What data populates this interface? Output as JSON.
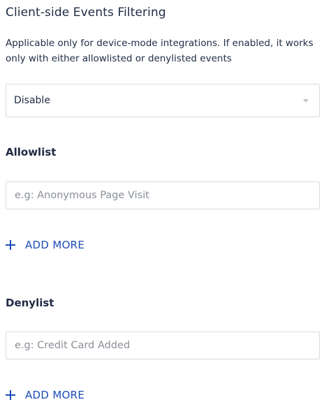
{
  "section": {
    "title": "Client-side Events Filtering",
    "description": "Applicable only for device-mode integrations. If enabled, it works only with either allowlisted or denylisted events"
  },
  "filter_select": {
    "selected": "Disable"
  },
  "allowlist": {
    "label": "Allowlist",
    "placeholder": "e.g: Anonymous Page Visit",
    "value": "",
    "add_more_label": "ADD MORE"
  },
  "denylist": {
    "label": "Denylist",
    "placeholder": "e.g: Credit Card Added",
    "value": "",
    "add_more_label": "ADD MORE"
  },
  "colors": {
    "text": "#1f2a44",
    "accent": "#1e4db7",
    "border": "#d7dbe2",
    "placeholder": "#8a8f98"
  },
  "icons": {
    "dropdown": "chevron-down-icon",
    "add": "plus-icon"
  }
}
